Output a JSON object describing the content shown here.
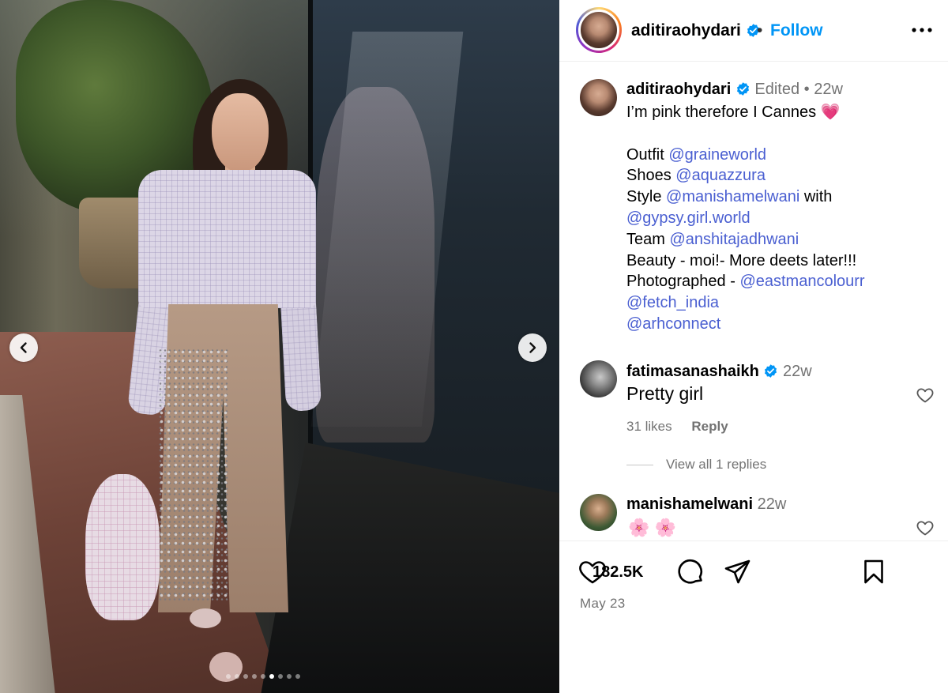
{
  "post": {
    "username": "aditiraohydari",
    "follow_label": "Follow",
    "header_dot": "•",
    "media": {
      "dot_count": 9,
      "active_dot": 5,
      "prev_icon": "chevron-left-icon",
      "next_icon": "chevron-right-icon"
    }
  },
  "caption": {
    "username": "aditiraohydari",
    "edited": "Edited",
    "dot": "•",
    "age": "22w",
    "first_line": "I’m pink therefore I Cannes 💗",
    "lines": [
      {
        "label": "Outfit ",
        "mention": "@graineworld",
        "suffix": ""
      },
      {
        "label": "Shoes ",
        "mention": "@aquazzura",
        "suffix": ""
      },
      {
        "label": "Style ",
        "mention": "@manishamelwani",
        "suffix": " with"
      },
      {
        "label": "",
        "mention": "@gypsy.girl.world",
        "suffix": ""
      },
      {
        "label": "Team ",
        "mention": "@anshitajadhwani",
        "suffix": ""
      },
      {
        "label": "Beauty -  moi!- More deets later!!!",
        "mention": "",
        "suffix": ""
      },
      {
        "label": "Photographed - ",
        "mention": "@eastmancolourr",
        "suffix": ""
      },
      {
        "label": "",
        "mention": "@fetch_india",
        "suffix": ""
      },
      {
        "label": "",
        "mention": "@arhconnect",
        "suffix": ""
      }
    ]
  },
  "comments": [
    {
      "username": "fatimasanashaikh",
      "age": "22w",
      "text": "Pretty girl",
      "likes": "31 likes",
      "reply_label": "Reply",
      "view_replies": "View all 1 replies"
    },
    {
      "username": "manishamelwani",
      "age": "22w",
      "text": "🌸 🌸"
    }
  ],
  "actions": {
    "like_count": "182.5K",
    "date": "May 23",
    "icons": [
      "heart-icon",
      "comment-icon",
      "share-icon",
      "bookmark-icon"
    ]
  },
  "colors": {
    "link": "#0095f6",
    "mention": "#4a5fd1",
    "verified": "#0095f6",
    "muted": "#737373"
  }
}
